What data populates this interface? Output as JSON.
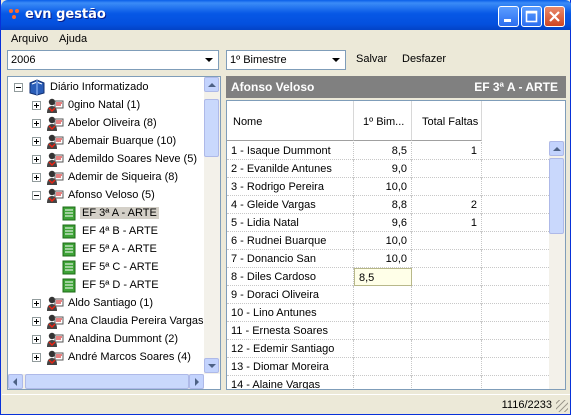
{
  "window": {
    "title": "evn gestão"
  },
  "menu": [
    "Arquivo",
    "Ajuda"
  ],
  "toolbar": {
    "year": "2006",
    "period": "1º Bimestre",
    "save_label": "Salvar",
    "undo_label": "Desfazer"
  },
  "tree": {
    "root": "Diário Informatizado",
    "items": [
      {
        "label": "0gino Natal (1)",
        "kind": "teacher",
        "expanded": false
      },
      {
        "label": "Abelor Oliveira (8)",
        "kind": "teacher",
        "expanded": false
      },
      {
        "label": "Abemair Buarque (10)",
        "kind": "teacher",
        "expanded": false
      },
      {
        "label": "Ademildo Soares Neve (5)",
        "kind": "teacher",
        "expanded": false
      },
      {
        "label": "Ademir de Siqueira (8)",
        "kind": "teacher",
        "expanded": false
      },
      {
        "label": "Afonso Veloso (5)",
        "kind": "teacher",
        "expanded": true
      },
      {
        "label": "EF 3ª A - ARTE",
        "kind": "class",
        "selected": true
      },
      {
        "label": "EF 4ª B - ARTE",
        "kind": "class"
      },
      {
        "label": "EF 5ª A - ARTE",
        "kind": "class"
      },
      {
        "label": "EF 5ª C - ARTE",
        "kind": "class"
      },
      {
        "label": "EF 5ª D - ARTE",
        "kind": "class"
      },
      {
        "label": "Aldo Santiago (1)",
        "kind": "teacher",
        "expanded": false
      },
      {
        "label": "Ana Claudia Pereira Vargas (",
        "kind": "teacher",
        "expanded": false
      },
      {
        "label": "Analdina Dummont (2)",
        "kind": "teacher",
        "expanded": false
      },
      {
        "label": "André Marcos Soares (4)",
        "kind": "teacher",
        "expanded": false
      }
    ]
  },
  "grid": {
    "student_title": "Afonso Veloso",
    "class_title": "EF 3ª A - ARTE",
    "columns": [
      "Nome",
      "1º Bim...",
      "Total Faltas"
    ],
    "rows": [
      {
        "name": "1 - Isaque Dummont",
        "grade": "8,5",
        "absences": "1"
      },
      {
        "name": "2 - Evanilde Antunes",
        "grade": "9,0",
        "absences": ""
      },
      {
        "name": "3 - Rodrigo Pereira",
        "grade": "10,0",
        "absences": ""
      },
      {
        "name": "4 - Gleide Vargas",
        "grade": "8,8",
        "absences": "2"
      },
      {
        "name": "5 - Lidia Natal",
        "grade": "9,6",
        "absences": "1"
      },
      {
        "name": "6 - Rudnei Buarque",
        "grade": "10,0",
        "absences": ""
      },
      {
        "name": "7 - Donancio San",
        "grade": "10,0",
        "absences": ""
      },
      {
        "name": "8 - Diles Cardoso",
        "grade": "8,5",
        "absences": "",
        "editing": true
      },
      {
        "name": "9 - Doraci Oliveira",
        "grade": "",
        "absences": ""
      },
      {
        "name": "10 - Lino Antunes",
        "grade": "",
        "absences": ""
      },
      {
        "name": "11 - Ernesta Soares",
        "grade": "",
        "absences": ""
      },
      {
        "name": "12 - Edemir Santiago",
        "grade": "",
        "absences": ""
      },
      {
        "name": "13 - Diomar Moreira",
        "grade": "",
        "absences": ""
      },
      {
        "name": "14 - Alaine Vargas",
        "grade": "",
        "absences": ""
      }
    ]
  },
  "status": {
    "count": "1116/2233"
  },
  "colors": {
    "title_bar": "#0450de",
    "grid_header": "#808080",
    "edit_cell": "#ffffe8"
  }
}
